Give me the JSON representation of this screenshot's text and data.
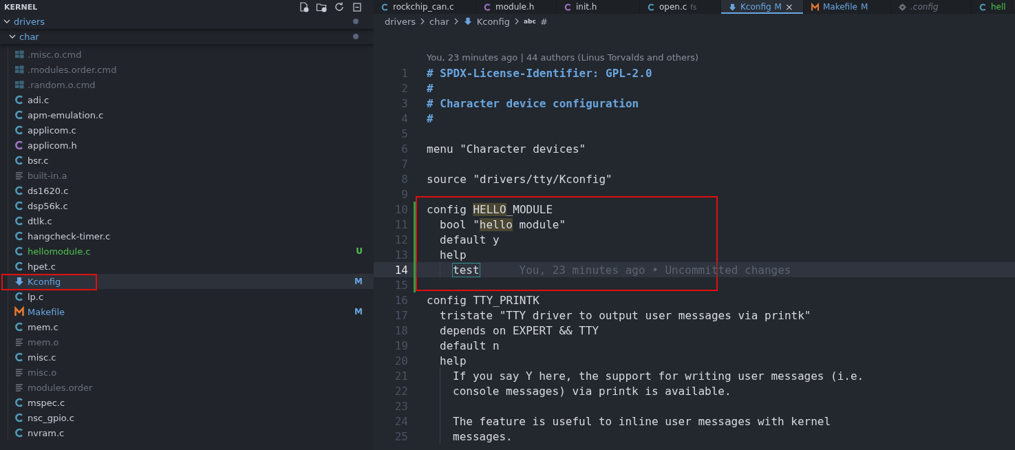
{
  "explorer": {
    "title": "KERNEL",
    "tree": [
      {
        "label": "drivers",
        "kind": "folder",
        "expanded": true,
        "modified": true,
        "children": [
          {
            "label": "char",
            "kind": "folder",
            "expanded": true,
            "modified": true,
            "children": [
              {
                "label": ".misc.o.cmd",
                "kind": "windows",
                "ignored": true,
                "selected": false,
                "boxed": false
              },
              {
                "label": ".modules.order.cmd",
                "kind": "windows",
                "ignored": true,
                "selected": false,
                "boxed": false
              },
              {
                "label": ".random.o.cmd",
                "kind": "windows",
                "ignored": true,
                "selected": false,
                "boxed": false
              },
              {
                "label": "adi.c",
                "kind": "c",
                "ignored": false,
                "selected": false,
                "boxed": false
              },
              {
                "label": "apm-emulation.c",
                "kind": "c",
                "ignored": false,
                "selected": false,
                "boxed": false
              },
              {
                "label": "applicom.c",
                "kind": "c",
                "ignored": false,
                "selected": false,
                "boxed": false
              },
              {
                "label": "applicom.h",
                "kind": "h",
                "ignored": false,
                "selected": false,
                "boxed": false
              },
              {
                "label": "bsr.c",
                "kind": "c",
                "ignored": false,
                "selected": false,
                "boxed": false
              },
              {
                "label": "built-in.a",
                "kind": "text",
                "ignored": true,
                "selected": false,
                "boxed": false
              },
              {
                "label": "ds1620.c",
                "kind": "c",
                "ignored": false,
                "selected": false,
                "boxed": false
              },
              {
                "label": "dsp56k.c",
                "kind": "c",
                "ignored": false,
                "selected": false,
                "boxed": false
              },
              {
                "label": "dtlk.c",
                "kind": "c",
                "ignored": false,
                "selected": false,
                "boxed": false
              },
              {
                "label": "hangcheck-timer.c",
                "kind": "c",
                "ignored": false,
                "selected": false,
                "boxed": false
              },
              {
                "label": "hellomodule.c",
                "kind": "c",
                "untracked": true,
                "badge": "U",
                "ignored": false,
                "selected": false,
                "boxed": false
              },
              {
                "label": "hpet.c",
                "kind": "c",
                "ignored": false,
                "selected": false,
                "boxed": false
              },
              {
                "label": "Kconfig",
                "kind": "kconfig",
                "modified": true,
                "badge": "M",
                "ignored": false,
                "selected": true,
                "boxed": true
              },
              {
                "label": "lp.c",
                "kind": "c",
                "ignored": false,
                "selected": false,
                "boxed": false
              },
              {
                "label": "Makefile",
                "kind": "makefile",
                "modified": true,
                "badge": "M",
                "ignored": false,
                "selected": false,
                "boxed": false
              },
              {
                "label": "mem.c",
                "kind": "c",
                "ignored": false,
                "selected": false,
                "boxed": false
              },
              {
                "label": "mem.o",
                "kind": "text",
                "ignored": true,
                "selected": false,
                "boxed": false
              },
              {
                "label": "misc.c",
                "kind": "c",
                "ignored": false,
                "selected": false,
                "boxed": false
              },
              {
                "label": "misc.o",
                "kind": "text",
                "ignored": true,
                "selected": false,
                "boxed": false
              },
              {
                "label": "modules.order",
                "kind": "text",
                "ignored": true,
                "selected": false,
                "boxed": false
              },
              {
                "label": "mspec.c",
                "kind": "c",
                "ignored": false,
                "selected": false,
                "boxed": false
              },
              {
                "label": "nsc_gpio.c",
                "kind": "c",
                "ignored": false,
                "selected": false,
                "boxed": false
              },
              {
                "label": "nvram.c",
                "kind": "c",
                "ignored": false,
                "selected": false,
                "boxed": false
              }
            ]
          }
        ]
      }
    ]
  },
  "tabs": [
    {
      "label": "rockchip_can.c",
      "kind": "c",
      "selected": false,
      "preview": false
    },
    {
      "label": "module.h",
      "kind": "h",
      "selected": false,
      "preview": false
    },
    {
      "label": "init.h",
      "kind": "h",
      "selected": false,
      "preview": false
    },
    {
      "label": "open.c",
      "kind": "c",
      "description": "fs",
      "selected": false,
      "preview": false
    },
    {
      "label": "Kconfig",
      "kind": "kconfig",
      "badge": "M",
      "modified": true,
      "selected": true,
      "preview": false,
      "close": "×"
    },
    {
      "label": "Makefile",
      "kind": "makefile",
      "badge": "M",
      "modified": true,
      "selected": false,
      "preview": false
    },
    {
      "label": ".config",
      "kind": "gear",
      "selected": false,
      "preview": true
    },
    {
      "label": "hell",
      "kind": "c",
      "untracked": true,
      "selected": false,
      "preview": false
    }
  ],
  "breadcrumbs": [
    {
      "label": "drivers",
      "kind": "folder"
    },
    {
      "label": "char",
      "kind": "folder"
    },
    {
      "label": "Kconfig",
      "kind": "kconfig"
    },
    {
      "label": "#",
      "kind": "symbol",
      "symbol_icon": "abc"
    }
  ],
  "editor": {
    "codelens": "You, 23 minutes ago | 44 authors (Linus Torvalds and others)",
    "lines": [
      {
        "number": "1",
        "kind": "top",
        "added": false,
        "current": false,
        "boxed": false,
        "segments": [
          {
            "text": "# SPDX-License-Identifier: GPL-2.0",
            "kind": "comment"
          }
        ]
      },
      {
        "number": "2",
        "kind": "top",
        "added": false,
        "current": false,
        "boxed": false,
        "segments": [
          {
            "text": "#",
            "kind": "comment"
          }
        ]
      },
      {
        "number": "3",
        "kind": "top",
        "added": false,
        "current": false,
        "boxed": false,
        "segments": [
          {
            "text": "# Character device configuration",
            "kind": "comment"
          }
        ]
      },
      {
        "number": "4",
        "kind": "top",
        "added": false,
        "current": false,
        "boxed": false,
        "segments": [
          {
            "text": "#",
            "kind": "comment"
          }
        ]
      },
      {
        "number": "5",
        "kind": "top",
        "added": false,
        "current": false,
        "boxed": false
      },
      {
        "number": "6",
        "kind": "top",
        "added": false,
        "current": false,
        "boxed": false,
        "segments": [
          {
            "text": "menu \"Character devices\"",
            "kind": "plain"
          }
        ]
      },
      {
        "number": "7",
        "kind": "top",
        "added": false,
        "current": false,
        "boxed": false
      },
      {
        "number": "8",
        "kind": "top",
        "added": false,
        "current": false,
        "boxed": false,
        "segments": [
          {
            "text": "source \"drivers/tty/Kconfig\"",
            "kind": "plain"
          }
        ]
      },
      {
        "number": "9",
        "kind": "top",
        "added": false,
        "current": false,
        "boxed": false
      },
      {
        "number": "10",
        "kind": "top",
        "added": true,
        "current": false,
        "boxed": true,
        "segments": [
          {
            "text": "config ",
            "kind": "plain"
          },
          {
            "text": "HELLO",
            "kind": "match"
          },
          {
            "text": "_MODULE",
            "kind": "plain"
          }
        ]
      },
      {
        "number": "11",
        "kind": "option",
        "added": true,
        "current": false,
        "boxed": true,
        "segments": [
          {
            "text": "bool \"",
            "kind": "plain"
          },
          {
            "text": "hello",
            "kind": "match"
          },
          {
            "text": " module\"",
            "kind": "plain"
          }
        ]
      },
      {
        "number": "12",
        "kind": "option",
        "added": true,
        "current": false,
        "boxed": true,
        "segments": [
          {
            "text": "default y",
            "kind": "plain"
          }
        ]
      },
      {
        "number": "13",
        "kind": "option",
        "added": true,
        "current": false,
        "boxed": true,
        "segments": [
          {
            "text": "help",
            "kind": "plain"
          }
        ]
      },
      {
        "number": "14",
        "kind": "help-body",
        "added": true,
        "current": true,
        "boxed": true,
        "segments": [
          {
            "text": "test",
            "kind": "cursor-word"
          }
        ],
        "blame": "You, 23 minutes ago • Uncommitted changes"
      },
      {
        "number": "15",
        "kind": "top",
        "added": true,
        "current": false,
        "boxed": true
      },
      {
        "number": "16",
        "kind": "top",
        "added": false,
        "current": false,
        "boxed": false,
        "segments": [
          {
            "text": "config TTY_PRINTK",
            "kind": "plain"
          }
        ]
      },
      {
        "number": "17",
        "kind": "option",
        "added": false,
        "current": false,
        "boxed": false,
        "segments": [
          {
            "text": "tristate \"TTY driver to output user messages via printk\"",
            "kind": "plain"
          }
        ]
      },
      {
        "number": "18",
        "kind": "option",
        "added": false,
        "current": false,
        "boxed": false,
        "segments": [
          {
            "text": "depends on EXPERT && TTY",
            "kind": "plain"
          }
        ]
      },
      {
        "number": "19",
        "kind": "option",
        "added": false,
        "current": false,
        "boxed": false,
        "segments": [
          {
            "text": "default n",
            "kind": "plain"
          }
        ]
      },
      {
        "number": "20",
        "kind": "option",
        "added": false,
        "current": false,
        "boxed": false,
        "segments": [
          {
            "text": "help",
            "kind": "plain"
          }
        ]
      },
      {
        "number": "21",
        "kind": "help-body",
        "added": false,
        "current": false,
        "boxed": false,
        "segments": [
          {
            "text": "If you say Y here, the support for writing user messages (i.e.",
            "kind": "plain"
          }
        ]
      },
      {
        "number": "22",
        "kind": "help-body",
        "added": false,
        "current": false,
        "boxed": false,
        "segments": [
          {
            "text": "console messages) via printk is available.",
            "kind": "plain"
          }
        ]
      },
      {
        "number": "23",
        "kind": "help-body",
        "added": false,
        "current": false,
        "boxed": false
      },
      {
        "number": "24",
        "kind": "help-body",
        "added": false,
        "current": false,
        "boxed": false,
        "segments": [
          {
            "text": "The feature is useful to inline user messages with kernel",
            "kind": "plain"
          }
        ]
      },
      {
        "number": "25",
        "kind": "help-body",
        "added": false,
        "current": false,
        "boxed": false,
        "segments": [
          {
            "text": "messages.",
            "kind": "plain"
          }
        ]
      }
    ]
  }
}
